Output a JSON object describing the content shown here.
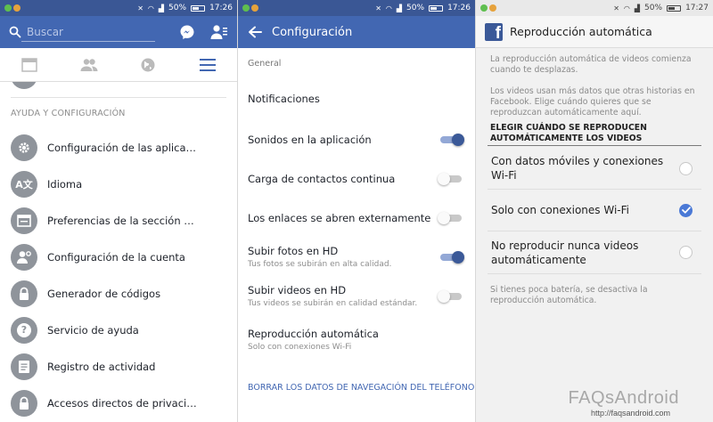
{
  "status": {
    "s1": {
      "battery": "50%",
      "time": "17:26"
    },
    "s2": {
      "battery": "50%",
      "time": "17:26"
    },
    "s3": {
      "battery": "50%",
      "time": "17:27"
    }
  },
  "screen1": {
    "search_placeholder": "Buscar",
    "section_title": "AYUDA Y CONFIGURACIÓN",
    "menu_items": [
      {
        "label": "Configuración de las aplicaciones"
      },
      {
        "label": "Idioma"
      },
      {
        "label": "Preferencias de la sección de noticias"
      },
      {
        "label": "Configuración de la cuenta"
      },
      {
        "label": "Generador de códigos"
      },
      {
        "label": "Servicio de ayuda"
      },
      {
        "label": "Registro de actividad"
      },
      {
        "label": "Accesos directos de privacidad"
      }
    ]
  },
  "screen2": {
    "title": "Configuración",
    "section_general": "General",
    "rows": [
      {
        "title": "Notificaciones"
      },
      {
        "title": "Sonidos en la aplicación",
        "toggle_on": true
      },
      {
        "title": "Carga de contactos continua",
        "toggle_on": false
      },
      {
        "title": "Los enlaces se abren externamente",
        "toggle_on": false
      },
      {
        "title": "Subir fotos en HD",
        "subtitle": "Tus fotos se subirán en alta calidad.",
        "toggle_on": true
      },
      {
        "title": "Subir videos en HD",
        "subtitle": "Tus videos se subirán en calidad estándar.",
        "toggle_on": false
      },
      {
        "title": "Reproducción automática",
        "subtitle": "Solo con conexiones Wi-Fi"
      }
    ],
    "clear_browsing_label": "BORRAR LOS DATOS DE NAVEGACIÓN DEL TELÉFONO"
  },
  "screen3": {
    "title": "Reproducción automática",
    "intro": "La reproducción automática de videos comienza cuando te desplazas.",
    "data_note": "Los videos usan más datos que otras historias en Facebook. Elige cuándo quieres que se reproduzcan automáticamente aquí.",
    "choose_heading": "ELEGIR CUÁNDO SE REPRODUCEN AUTOMÁTICAMENTE LOS VIDEOS",
    "options": [
      {
        "label": "Con datos móviles y conexiones Wi-Fi",
        "selected": false
      },
      {
        "label": "Solo con conexiones Wi-Fi",
        "selected": true
      },
      {
        "label": "No reproducir nunca videos automáticamente",
        "selected": false
      }
    ],
    "battery_note": "Si tienes poca batería, se desactiva la reproducción automática."
  },
  "watermark": {
    "brand": "FAQsAndroid",
    "url": "http://faqsandroid.com"
  },
  "colors": {
    "facebook_blue": "#4267b2",
    "status_blue": "#3a5795",
    "toggle_on": "#3b5998",
    "radio_selected": "#4a79d6"
  }
}
